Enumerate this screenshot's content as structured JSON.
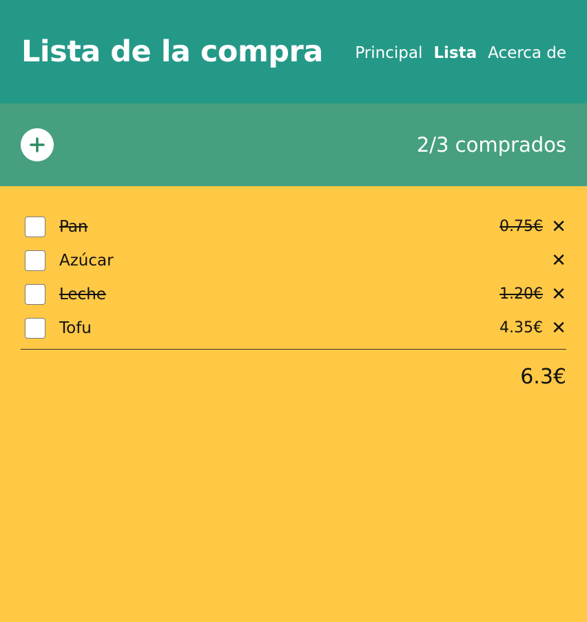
{
  "header": {
    "title": "Lista de la compra",
    "nav": [
      {
        "label": "Principal",
        "active": false
      },
      {
        "label": "Lista",
        "active": true
      },
      {
        "label": "Acerca de",
        "active": false
      }
    ]
  },
  "toolbar": {
    "add_icon": "plus-icon",
    "counter": "2/3 comprados"
  },
  "items": [
    {
      "name": "Pan",
      "price": "0.75€",
      "bought": true
    },
    {
      "name": "Azúcar",
      "price": "",
      "bought": false
    },
    {
      "name": "Leche",
      "price": "1.20€",
      "bought": true
    },
    {
      "name": "Tofu",
      "price": "4.35€",
      "bought": false
    }
  ],
  "remove_symbol": "✕",
  "total": "6.3€",
  "colors": {
    "header": "#259988",
    "toolbar": "#46A07F",
    "background": "#FFC845",
    "accent": "#2E8B5F"
  }
}
